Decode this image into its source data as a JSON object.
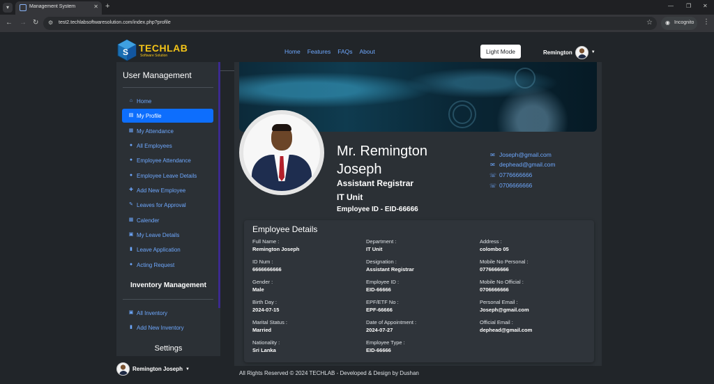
{
  "browser": {
    "tab_title": "Management System",
    "url": "test2.techlabsoftwaresolution.com/index.php?profile",
    "incognito_label": "Incognito"
  },
  "brand": {
    "name_a": "TECH",
    "name_b": "LAB",
    "tagline": "Software Solution"
  },
  "topnav": {
    "items": [
      "Home",
      "Features",
      "FAQs",
      "About"
    ]
  },
  "header": {
    "theme_button": "Light Mode",
    "user_name": "Remington"
  },
  "sidebar": {
    "title": "User Management",
    "items": [
      {
        "label": "Home",
        "icon": "home-icon",
        "glyph": "⌂"
      },
      {
        "label": "My Profile",
        "icon": "id-card-icon",
        "glyph": "▤"
      },
      {
        "label": "My Attendance",
        "icon": "calendar-icon",
        "glyph": "▦"
      },
      {
        "label": "All Employees",
        "icon": "user-icon",
        "glyph": "●"
      },
      {
        "label": "Employee Attendance",
        "icon": "user-icon",
        "glyph": "●"
      },
      {
        "label": "Employee Leave Details",
        "icon": "user-icon",
        "glyph": "●"
      },
      {
        "label": "Add New Employee",
        "icon": "user-plus-icon",
        "glyph": "✚"
      },
      {
        "label": "Leaves for Approval",
        "icon": "edit-icon",
        "glyph": "✎"
      },
      {
        "label": "Calender",
        "icon": "calendar-icon",
        "glyph": "▦"
      },
      {
        "label": "My Leave Details",
        "icon": "table-icon",
        "glyph": "▣"
      },
      {
        "label": "Leave Application",
        "icon": "file-icon",
        "glyph": "▮"
      },
      {
        "label": "Acting Request",
        "icon": "users-cog-icon",
        "glyph": "●"
      }
    ],
    "inventory_title": "Inventory Management",
    "inventory_items": [
      {
        "label": "All Inventory",
        "icon": "table-icon",
        "glyph": "▣"
      },
      {
        "label": "Add New Inventory",
        "icon": "file-plus-icon",
        "glyph": "▮"
      }
    ],
    "settings_title": "Settings",
    "footer_user": "Remington Joseph"
  },
  "profile": {
    "name": "Mr. Remington Joseph",
    "designation": "Assistant Registrar",
    "unit": "IT Unit",
    "employee_id": "Employee ID - EID-66666",
    "contacts": [
      {
        "icon": "envelope-icon",
        "glyph": "✉",
        "text": "Joseph@gmail.com"
      },
      {
        "icon": "envelope-icon",
        "glyph": "✉",
        "text": "dephead@gmail.com"
      },
      {
        "icon": "phone-icon",
        "glyph": "☏",
        "text": "0776666666"
      },
      {
        "icon": "phone-icon",
        "glyph": "☏",
        "text": "0706666666"
      }
    ]
  },
  "details": {
    "title": "Employee Details",
    "col1": [
      {
        "label": "Full Name :",
        "value": "Remington Joseph"
      },
      {
        "label": "ID Num :",
        "value": "6666666666"
      },
      {
        "label": "Gender :",
        "value": "Male"
      },
      {
        "label": "Birth Day :",
        "value": "2024-07-15"
      },
      {
        "label": "Marital Status :",
        "value": "Married"
      },
      {
        "label": "Nationality :",
        "value": "Sri Lanka"
      }
    ],
    "col2": [
      {
        "label": "Department :",
        "value": "IT Unit"
      },
      {
        "label": "Designation :",
        "value": "Assistant Registrar"
      },
      {
        "label": "Employee ID :",
        "value": "EID-66666"
      },
      {
        "label": "EPF/ETF No :",
        "value": "EPF-66666"
      },
      {
        "label": "Date of Appointment :",
        "value": "2024-07-27"
      },
      {
        "label": "Employee Type :",
        "value": "EID-66666"
      }
    ],
    "col3": [
      {
        "label": "Address :",
        "value": "colombo 05"
      },
      {
        "label": "Mobile No Personal :",
        "value": "0776666666"
      },
      {
        "label": "Mobile No Official :",
        "value": "0706666666"
      },
      {
        "label": "Personal Email :",
        "value": "Joseph@gmail.com"
      },
      {
        "label": "Official Email :",
        "value": "dephead@gmail.com"
      }
    ]
  },
  "footer": {
    "text": "All Rights Reserved © 2024 TECHLAB - Developed & Design by Dushan"
  },
  "colors": {
    "accent": "#0d6efd",
    "link": "#6ea8fe",
    "brand": "#f5c518"
  }
}
